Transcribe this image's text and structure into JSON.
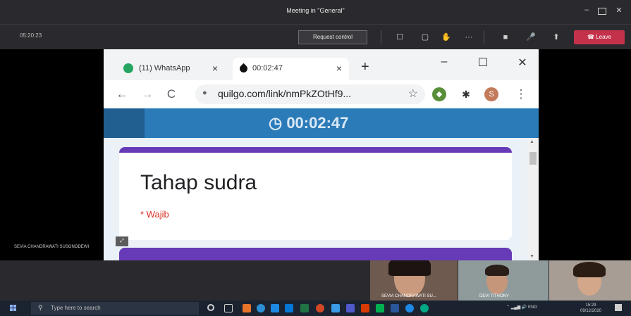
{
  "teams": {
    "window_title": "Meeting in \"General\"",
    "meeting_time": "05:20:23",
    "request_control_label": "Request control",
    "leave_label": "Leave",
    "presenter_name": "SEVIA CHANDRAWATI SUSONODEWI"
  },
  "browser": {
    "tabs": [
      {
        "label": "(11) WhatsApp",
        "favicon": "whatsapp-icon",
        "active": false
      },
      {
        "label": "00:02:47",
        "favicon": "quilgo-icon",
        "active": true
      }
    ],
    "url": "quilgo.com/link/nmPkZOtHf9...",
    "profile_initial": "S"
  },
  "page": {
    "timer": "00:02:47",
    "form_title": "Tahap sudra",
    "required_note": "* Wajib"
  },
  "participants": [
    {
      "label": "SEVIA CHANDRAWATI SU..."
    },
    {
      "label": "DEVI TITHONY"
    },
    {
      "label": ""
    }
  ],
  "taskbar": {
    "search_placeholder": "Type here to search",
    "language": "ENG",
    "time": "15:29",
    "date": "09/12/2020"
  },
  "colors": {
    "teams_bg": "#2a2a2e",
    "leave_red": "#c4314b",
    "timer_blue": "#2b7bb9",
    "form_purple": "#673ab7",
    "required_red": "#d93025"
  }
}
